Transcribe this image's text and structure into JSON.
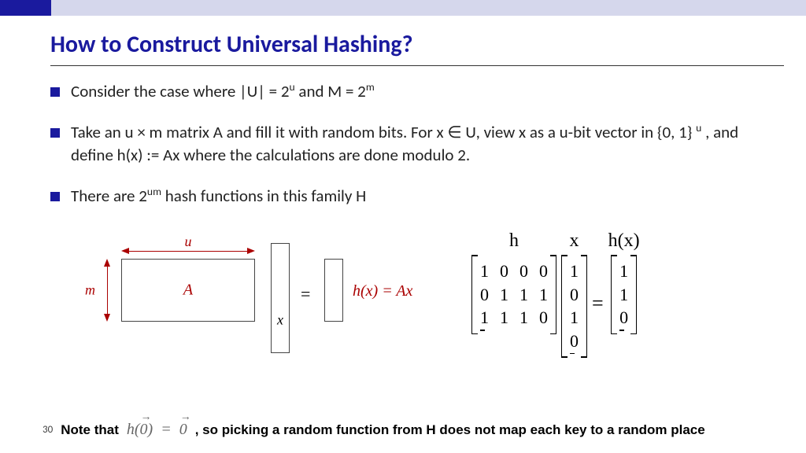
{
  "title": "How to Construct Universal Hashing?",
  "bullets": {
    "b1_a": "Consider the case where |U| = 2",
    "b1_sup1": "u",
    "b1_b": " and M = 2",
    "b1_sup2": "m",
    "b2_a": "Take an u × m matrix A and fill it with random bits. For x ∈ U, view x as a u-bit vector in {0, 1} ",
    "b2_sup": "u",
    "b2_b": " , and define h(x) := Ax where the calculations are done modulo 2.",
    "b3_a": "There are 2",
    "b3_sup": "um",
    "b3_b": " hash functions in this family H"
  },
  "diagL": {
    "u": "u",
    "m": "m",
    "A": "A",
    "x": "x",
    "eq": "=",
    "hx": "h(x) = Ax"
  },
  "diagR": {
    "hdr_h": "h",
    "hdr_x": "x",
    "hdr_hx": "h(x)",
    "matrix": [
      [
        "1",
        "0",
        "0",
        "0"
      ],
      [
        "0",
        "1",
        "1",
        "1"
      ],
      [
        "1",
        "1",
        "1",
        "0"
      ]
    ],
    "xvec": [
      "1",
      "0",
      "1",
      "0"
    ],
    "eq": "=",
    "hxvec": [
      "1",
      "1",
      "0"
    ]
  },
  "footer": {
    "page": "30",
    "note_a": "Note that ",
    "math": "h(0⃗)  =  0⃗",
    "note_b": " , so picking a random function from H does not map each key to a random place"
  }
}
